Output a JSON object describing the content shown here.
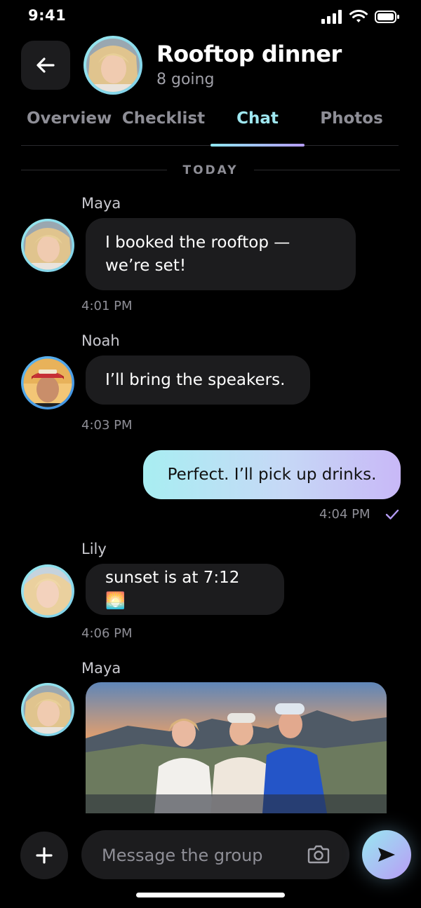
{
  "status_bar": {
    "time": "9:41",
    "icons": [
      "cellular-signal-icon",
      "wifi-icon",
      "battery-icon"
    ]
  },
  "header": {
    "back_icon": "arrow-left-icon",
    "title": "Rooftop dinner",
    "subtitle": "8 going"
  },
  "tabs": [
    {
      "label": "Overview",
      "active": false
    },
    {
      "label": "Checklist",
      "active": false
    },
    {
      "label": "Chat",
      "active": true
    },
    {
      "label": "Photos",
      "active": false
    }
  ],
  "date_divider": "TODAY",
  "messages": [
    {
      "sender": "Maya",
      "text_line1": "I booked the rooftop —",
      "text_line2": "we’re set!",
      "time": "4:01 PM"
    },
    {
      "sender": "Noah",
      "text": "I’ll bring the speakers.",
      "time": "4:03 PM"
    },
    {
      "outgoing": true,
      "text": "Perfect. I’ll pick up drinks.",
      "time": "4:04 PM",
      "status_icon": "checkmark-icon"
    },
    {
      "sender": "Lily",
      "text": "sunset is at 7:12 🌅",
      "time": "4:06 PM"
    },
    {
      "sender": "Maya",
      "attachment": "photo"
    }
  ],
  "composer": {
    "placeholder": "Message the group",
    "plus_icon": "plus-icon",
    "camera_icon": "camera-icon",
    "send_icon": "send-icon"
  },
  "colors": {
    "background": "#000000",
    "bubble": "#1c1c1e",
    "accent_start": "#98e8f0",
    "accent_end": "#b99cf6",
    "muted": "#8e8e96"
  }
}
